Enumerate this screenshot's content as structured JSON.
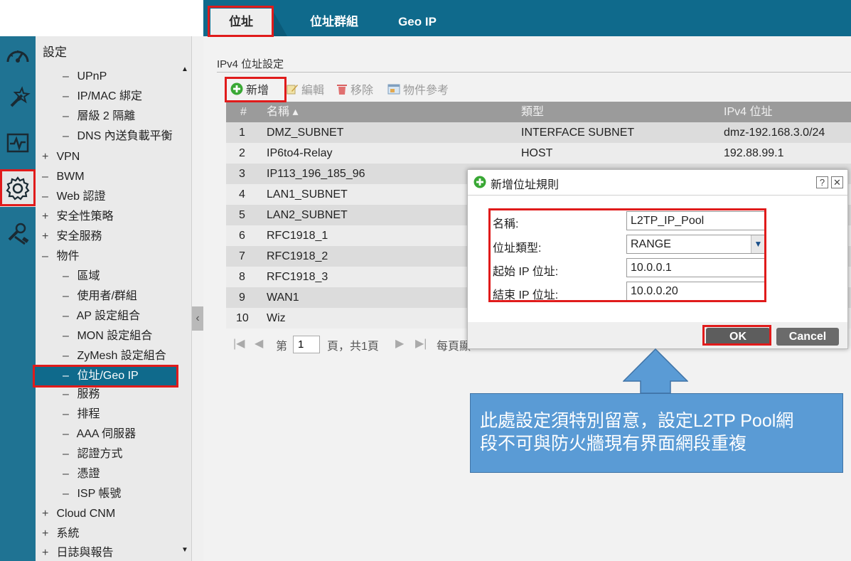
{
  "tabs": [
    {
      "label": "位址",
      "active": true
    },
    {
      "label": "位址群組",
      "active": false
    },
    {
      "label": "Geo IP",
      "active": false
    }
  ],
  "rail": [
    {
      "icon": "dashboard-icon"
    },
    {
      "icon": "wizard-icon"
    },
    {
      "icon": "monitor-icon"
    },
    {
      "icon": "gear-icon",
      "active": true
    },
    {
      "icon": "maintenance-icon"
    }
  ],
  "nav": {
    "title": "設定",
    "items": [
      {
        "mark": "–",
        "label": "UPnP",
        "level": 2
      },
      {
        "mark": "–",
        "label": "IP/MAC 綁定",
        "level": 2
      },
      {
        "mark": "–",
        "label": "層級 2 隔離",
        "level": 2
      },
      {
        "mark": "–",
        "label": "DNS 內送負載平衡",
        "level": 2
      },
      {
        "mark": "+",
        "label": "VPN",
        "level": 1
      },
      {
        "mark": "–",
        "label": "BWM",
        "level": 1
      },
      {
        "mark": "–",
        "label": "Web 認證",
        "level": 1
      },
      {
        "mark": "+",
        "label": "安全性策略",
        "level": 1
      },
      {
        "mark": "+",
        "label": "安全服務",
        "level": 1
      },
      {
        "mark": "–",
        "label": "物件",
        "level": 1
      },
      {
        "mark": "–",
        "label": "區域",
        "level": 2
      },
      {
        "mark": "–",
        "label": "使用者/群組",
        "level": 2
      },
      {
        "mark": "–",
        "label": "AP 設定組合",
        "level": 2
      },
      {
        "mark": "–",
        "label": "MON 設定組合",
        "level": 2
      },
      {
        "mark": "–",
        "label": "ZyMesh 設定組合",
        "level": 2
      },
      {
        "mark": "–",
        "label": "位址/Geo IP",
        "level": 2,
        "selected": true
      },
      {
        "mark": "–",
        "label": "服務",
        "level": 2
      },
      {
        "mark": "–",
        "label": "排程",
        "level": 2
      },
      {
        "mark": "–",
        "label": "AAA 伺服器",
        "level": 2
      },
      {
        "mark": "–",
        "label": "認證方式",
        "level": 2
      },
      {
        "mark": "–",
        "label": "憑證",
        "level": 2
      },
      {
        "mark": "–",
        "label": "ISP 帳號",
        "level": 2
      },
      {
        "mark": "+",
        "label": "Cloud CNM",
        "level": 1
      },
      {
        "mark": "+",
        "label": "系統",
        "level": 1
      },
      {
        "mark": "+",
        "label": "日誌與報告",
        "level": 1
      }
    ]
  },
  "section": {
    "title": "IPv4 位址設定"
  },
  "toolbar": {
    "add_label": "新增",
    "edit_label": "編輯",
    "remove_label": "移除",
    "ref_label": "物件參考"
  },
  "table": {
    "headers": {
      "num": "#",
      "name": "名稱 ▴",
      "type": "類型",
      "ip": "IPv4 位址"
    },
    "rows": [
      {
        "num": "1",
        "name": "DMZ_SUBNET",
        "type": "INTERFACE SUBNET",
        "ip": "dmz-192.168.3.0/24"
      },
      {
        "num": "2",
        "name": "IP6to4-Relay",
        "type": "HOST",
        "ip": "192.88.99.1"
      },
      {
        "num": "3",
        "name": "IP113_196_185_96",
        "type": "",
        "ip": ""
      },
      {
        "num": "4",
        "name": "LAN1_SUBNET",
        "type": "",
        "ip": ""
      },
      {
        "num": "5",
        "name": "LAN2_SUBNET",
        "type": "",
        "ip": ""
      },
      {
        "num": "6",
        "name": "RFC1918_1",
        "type": "",
        "ip": ""
      },
      {
        "num": "7",
        "name": "RFC1918_2",
        "type": "",
        "ip": ""
      },
      {
        "num": "8",
        "name": "RFC1918_3",
        "type": "",
        "ip": ""
      },
      {
        "num": "9",
        "name": "WAN1",
        "type": "",
        "ip": ""
      },
      {
        "num": "10",
        "name": "Wiz",
        "type": "",
        "ip": ""
      }
    ]
  },
  "pager": {
    "prefix": "第",
    "page": "1",
    "suffix": "頁，共1頁",
    "per_page": "每頁顯"
  },
  "dialog": {
    "title": "新增位址規則",
    "help": "?",
    "close": "✕",
    "name_label": "名稱:",
    "name_value": "L2TP_IP_Pool",
    "type_label": "位址類型:",
    "type_value": "RANGE",
    "start_label": "起始 IP 位址:",
    "start_value": "10.0.0.1",
    "end_label": "結束 IP 位址:",
    "end_value": "10.0.0.20",
    "ok_label": "OK",
    "cancel_label": "Cancel"
  },
  "callout": {
    "line1": "此處設定須特別留意，設定L2TP Pool網",
    "line2": "段不可與防火牆現有界面網段重複"
  },
  "colors": {
    "header": "#0f6a8c",
    "highlight": "#e01b1b",
    "callout": "#5a9bd5"
  }
}
